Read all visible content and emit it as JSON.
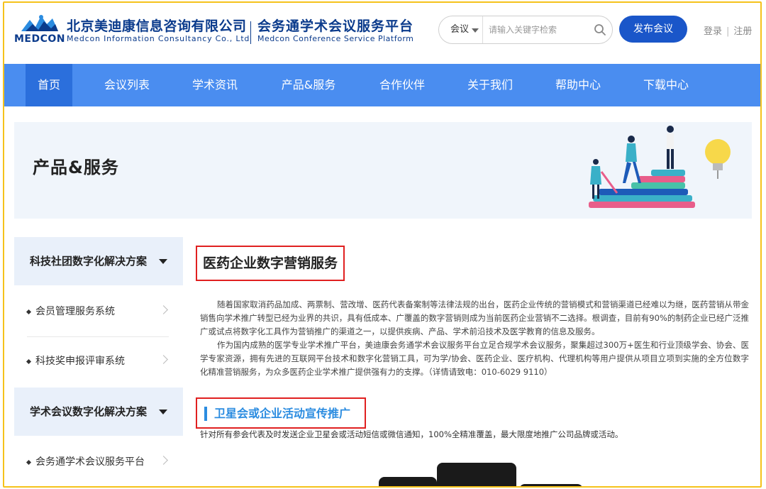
{
  "header": {
    "logo_word": "MEDCON",
    "company_cn": "北京美迪康信息咨询有限公司",
    "company_en": "Medcon Information Consultancy Co., Ltd",
    "platform_cn": "会务通学术会议服务平台",
    "platform_en": "Medcon Conference Service Platform",
    "search_type": "会议",
    "search_placeholder": "请输入关键字检索",
    "publish_label": "发布会议",
    "login_label": "登录",
    "register_label": "注册",
    "separator": "|"
  },
  "nav": {
    "items": [
      {
        "label": "首页"
      },
      {
        "label": "会议列表"
      },
      {
        "label": "学术资讯"
      },
      {
        "label": "产品&服务"
      },
      {
        "label": "合作伙伴"
      },
      {
        "label": "关于我们"
      },
      {
        "label": "帮助中心"
      },
      {
        "label": "下载中心"
      }
    ],
    "active_index": 0
  },
  "banner": {
    "title": "产品&服务"
  },
  "sidebar": {
    "groups": [
      {
        "title": "科技社团数字化解决方案",
        "items": [
          {
            "label": "会员管理服务系统"
          },
          {
            "label": "科技奖申报评审系统"
          }
        ]
      },
      {
        "title": "学术会议数字化解决方案",
        "items": [
          {
            "label": "会务通学术会议服务平台"
          }
        ]
      }
    ]
  },
  "main": {
    "section_title": "医药企业数字营销服务",
    "paragraphs": [
      "随着国家取消药品加成、两票制、营改增、医药代表备案制等法律法规的出台，医药企业传统的营销模式和营销渠道已经难以为继，医药营销从带金销售向学术推广转型已经为业界的共识，具有低成本、广覆盖的数字营销则成为当前医药企业营销不二选择。根调查，目前有90%的制药企业已经广泛推广或试点将数字化工具作为营销推广的渠道之一，以提供疾病、产品、学术前沿技术及医学教育的信息及服务。",
      "作为国内成熟的医学专业学术推广平台，美迪康会务通学术会议服务平台立足合规学术会议服务，聚集超过300万+医生和行业顶级学会、协会、医学专家资源，拥有先进的互联网平台技术和数字化营销工具，可为学/协会、医药企业、医疗机构、代理机构等用户提供从项目立项到实施的全方位数字化精准营销服务，为众多医药企业学术推广提供强有力的支撑。（详情请致电：010-6029 9110）"
    ],
    "sub_title": "卫星会或企业活动宣传推广",
    "sub_desc": "针对所有参会代表及时发送企业卫星会或活动短信或微信通知，100%全精准覆盖，最大限度地推广公司品牌或活动。"
  },
  "colors": {
    "brand_navy": "#0b3b8c",
    "nav_blue": "#4a8df0",
    "nav_active": "#2b6fdc",
    "publish_button": "#1a56c9",
    "highlight_red": "#e02020",
    "frame_yellow": "#f5c21b",
    "sub_title_blue": "#2b8ce0"
  },
  "icons": {
    "search": "search-icon",
    "dropdown": "caret-down-icon",
    "sidebar_expand": "triangle-down-icon",
    "sidebar_chevron": "chevron-right-icon"
  }
}
